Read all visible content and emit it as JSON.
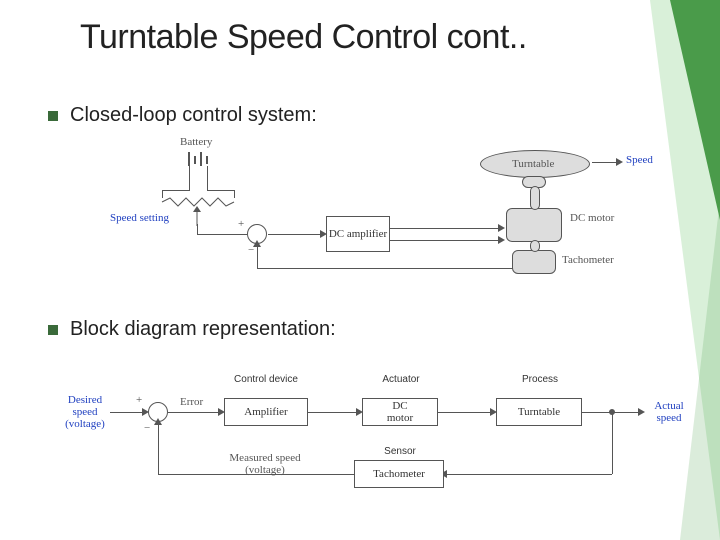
{
  "title": "Turntable Speed Control cont..",
  "bullets": {
    "b1": "Closed-loop control system:",
    "b2": "Block diagram representation:"
  },
  "circuit": {
    "battery": "Battery",
    "speed_setting": "Speed setting",
    "plus": "+",
    "minus": "−",
    "dc_amp": "DC amplifier",
    "turntable": "Turntable",
    "dc_motor": "DC motor",
    "tachometer": "Tachometer",
    "speed": "Speed"
  },
  "block": {
    "desired": "Desired\nspeed\n(voltage)",
    "plus": "+",
    "minus": "−",
    "error": "Error",
    "control_device": "Control device",
    "amplifier": "Amplifier",
    "actuator": "Actuator",
    "dc_motor": "DC\nmotor",
    "process": "Process",
    "turntable": "Turntable",
    "actual": "Actual\nspeed",
    "measured": "Measured speed\n(voltage)",
    "sensor": "Sensor",
    "tachometer": "Tachometer"
  }
}
